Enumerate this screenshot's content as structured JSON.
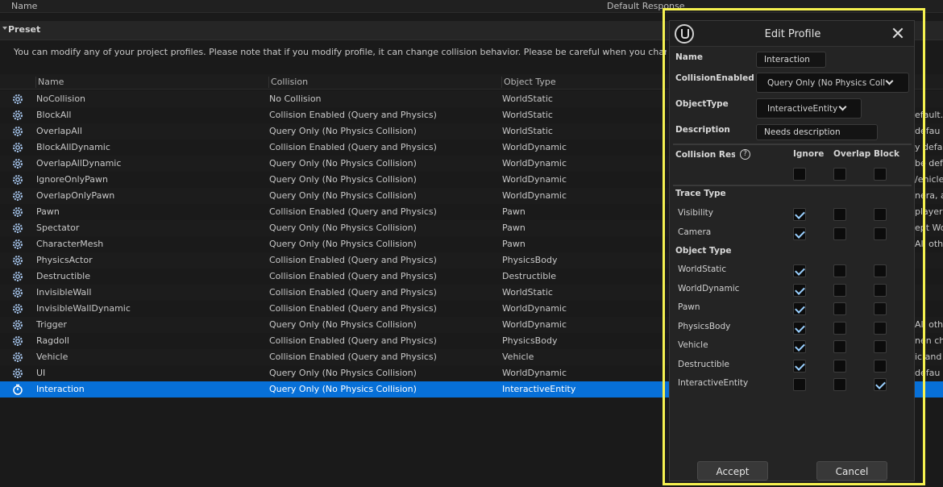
{
  "top_header": {
    "name": "Name",
    "default_response": "Default Response"
  },
  "preset": {
    "label": "Preset"
  },
  "notice": "You can modify any of your project profiles. Please note that if you modify profile, it can change collision behavior. Please be careful when you change currently »",
  "table": {
    "headers": [
      "Name",
      "Collision",
      "Object Type"
    ],
    "rows": [
      {
        "name": "NoCollision",
        "collision": "No Collision",
        "object_type": "WorldStatic",
        "desc": ""
      },
      {
        "name": "BlockAll",
        "collision": "Collision Enabled (Query and Physics)",
        "object_type": "WorldStatic",
        "desc": "efault."
      },
      {
        "name": "OverlapAll",
        "collision": "Query Only (No Physics Collision)",
        "object_type": "WorldStatic",
        "desc": "defau"
      },
      {
        "name": "BlockAllDynamic",
        "collision": "Collision Enabled (Query and Physics)",
        "object_type": "WorldDynamic",
        "desc": "y defau"
      },
      {
        "name": "OverlapAllDynamic",
        "collision": "Query Only (No Physics Collision)",
        "object_type": "WorldDynamic",
        "desc": "be def"
      },
      {
        "name": "IgnoreOnlyPawn",
        "collision": "Query Only (No Physics Collision)",
        "object_type": "WorldDynamic",
        "desc": "/ehicle"
      },
      {
        "name": "OverlapOnlyPawn",
        "collision": "Query Only (No Physics Collision)",
        "object_type": "WorldDynamic",
        "desc": "nera, a"
      },
      {
        "name": "Pawn",
        "collision": "Collision Enabled (Query and Physics)",
        "object_type": "Pawn",
        "desc": "playera"
      },
      {
        "name": "Spectator",
        "collision": "Query Only (No Physics Collision)",
        "object_type": "Pawn",
        "desc": "ept Wo"
      },
      {
        "name": "CharacterMesh",
        "collision": "Query Only (No Physics Collision)",
        "object_type": "Pawn",
        "desc": "All oth"
      },
      {
        "name": "PhysicsActor",
        "collision": "Collision Enabled (Query and Physics)",
        "object_type": "PhysicsBody",
        "desc": ""
      },
      {
        "name": "Destructible",
        "collision": "Collision Enabled (Query and Physics)",
        "object_type": "Destructible",
        "desc": ""
      },
      {
        "name": "InvisibleWall",
        "collision": "Collision Enabled (Query and Physics)",
        "object_type": "WorldStatic",
        "desc": ""
      },
      {
        "name": "InvisibleWallDynamic",
        "collision": "Collision Enabled (Query and Physics)",
        "object_type": "WorldDynamic",
        "desc": ""
      },
      {
        "name": "Trigger",
        "collision": "Query Only (No Physics Collision)",
        "object_type": "WorldDynamic",
        "desc": "All oth"
      },
      {
        "name": "Ragdoll",
        "collision": "Collision Enabled (Query and Physics)",
        "object_type": "PhysicsBody",
        "desc": "nen cha"
      },
      {
        "name": "Vehicle",
        "collision": "Collision Enabled (Query and Physics)",
        "object_type": "Vehicle",
        "desc": "ic and"
      },
      {
        "name": "UI",
        "collision": "Query Only (No Physics Collision)",
        "object_type": "WorldDynamic",
        "desc": "defau"
      },
      {
        "name": "Interaction",
        "collision": "Query Only (No Physics Collision)",
        "object_type": "InteractiveEntity",
        "desc": ""
      }
    ]
  },
  "dialog": {
    "title": "Edit Profile",
    "name_label": "Name",
    "name_value": "Interaction",
    "collision_enabled_label": "CollisionEnabled",
    "collision_enabled_value": "Query Only (No Physics Coll",
    "object_type_label": "ObjectType",
    "object_type_value": "InteractiveEntity",
    "description_label": "Description",
    "description_value": "Needs description",
    "collision_response_label": "Collision Respo",
    "col_ignore": "Ignore",
    "col_overlap": "Overlap",
    "col_block": "Block",
    "trace_type_label": "Trace Type",
    "object_type_section_label": "Object Type",
    "trace_types": [
      {
        "label": "Visibility",
        "response": "ignore"
      },
      {
        "label": "Camera",
        "response": "ignore"
      }
    ],
    "object_types": [
      {
        "label": "WorldStatic",
        "response": "ignore"
      },
      {
        "label": "WorldDynamic",
        "response": "ignore"
      },
      {
        "label": "Pawn",
        "response": "ignore"
      },
      {
        "label": "PhysicsBody",
        "response": "ignore"
      },
      {
        "label": "Vehicle",
        "response": "ignore"
      },
      {
        "label": "Destructible",
        "response": "ignore"
      },
      {
        "label": "InteractiveEntity",
        "response": "block"
      }
    ],
    "accept_label": "Accept",
    "cancel_label": "Cancel"
  },
  "colors": {
    "selection": "#0770d8",
    "highlight_frame": "#f6f250",
    "check": "#9ad0ff"
  }
}
